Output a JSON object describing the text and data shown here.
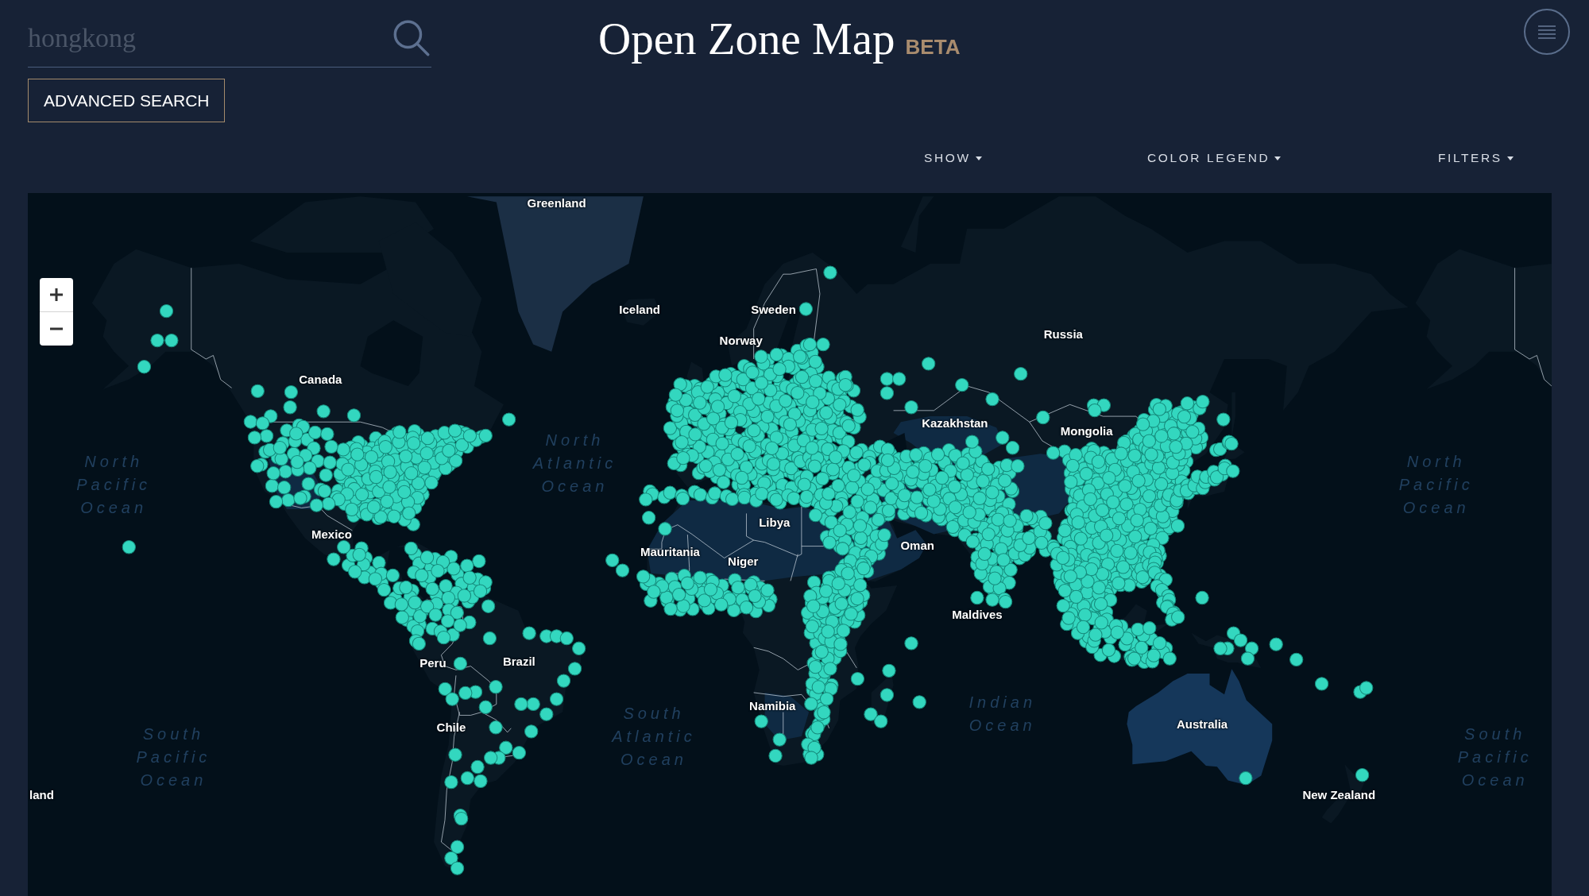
{
  "search": {
    "placeholder": "hongkong"
  },
  "advanced_search": {
    "label": "ADVANCED SEARCH"
  },
  "title": {
    "text": "Open Zone Map",
    "tag": "BETA"
  },
  "toolbar": [
    {
      "label": "SHOW"
    },
    {
      "label": "COLOR LEGEND"
    },
    {
      "label": "FILTERS"
    }
  ],
  "map": {
    "place_labels": [
      "Greenland",
      "Iceland",
      "Sweden",
      "Russia",
      "Norway",
      "Canada",
      "Kazakhstan",
      "Mongolia",
      "Libya",
      "Mexico",
      "Oman",
      "Mauritania",
      "Niger",
      "Maldives",
      "Brazil",
      "Peru",
      "Namibia",
      "Australia",
      "Chile",
      "land",
      "New Zealand"
    ],
    "ocean_labels": [
      "North Atlantic Ocean",
      "North Pacific Ocean",
      "North Pacific Ocean",
      "Indian Ocean",
      "South Atlantic Ocean",
      "South Pacific Ocean",
      "South Pacific Ocean"
    ]
  }
}
